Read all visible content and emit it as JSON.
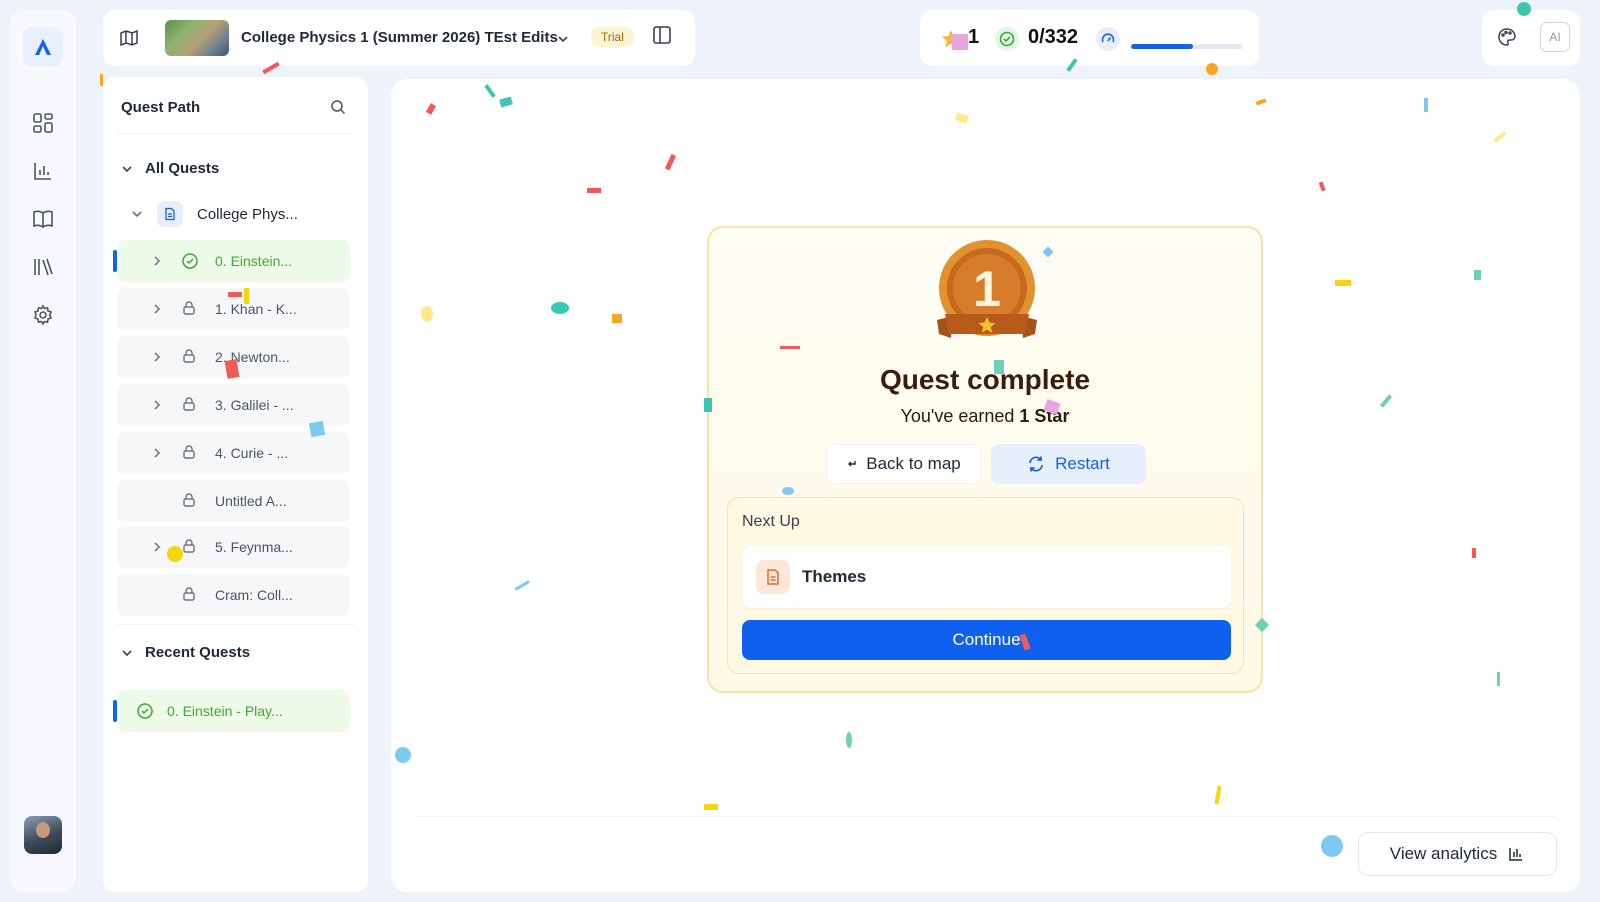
{
  "rail": {
    "nav_items": [
      "dashboard",
      "analytics",
      "book",
      "library",
      "settings"
    ]
  },
  "topbar": {
    "course_title": "College Physics 1 (Summer 2026) TEst Edits",
    "trial_badge": "Trial"
  },
  "stats": {
    "stars": "1",
    "progress": "0/332",
    "progress_fraction": 0.55
  },
  "top_right": {
    "ai_label": "AI"
  },
  "quest_panel": {
    "title": "Quest Path",
    "all_quests_label": "All Quests",
    "course_label": "College Phys...",
    "items": [
      {
        "label": "0. Einstein...",
        "state": "complete",
        "expandable": true
      },
      {
        "label": "1. Khan - K...",
        "state": "locked",
        "expandable": true
      },
      {
        "label": "2. Newton...",
        "state": "locked",
        "expandable": true
      },
      {
        "label": "3. Galilei - ...",
        "state": "locked",
        "expandable": true
      },
      {
        "label": "4. Curie - ...",
        "state": "locked",
        "expandable": true
      },
      {
        "label": "Untitled A...",
        "state": "locked",
        "expandable": false
      },
      {
        "label": "5. Feynma...",
        "state": "locked",
        "expandable": true
      },
      {
        "label": "Cram: Coll...",
        "state": "locked",
        "expandable": false
      }
    ],
    "recent_label": "Recent Quests",
    "recent_item": "0. Einstein - Play..."
  },
  "card": {
    "medal_number": "1",
    "title": "Quest complete",
    "subtitle_prefix": "You've earned ",
    "subtitle_bold": "1 Star",
    "back_label": "Back to map",
    "restart_label": "Restart",
    "next_up_label": "Next Up",
    "next_item": "Themes",
    "continue_label": "Continue"
  },
  "footer": {
    "analytics_label": "View analytics"
  },
  "colors": {
    "primary": "#1060f0",
    "success": "#3ea935",
    "medal": "#c8691f",
    "card_border": "#f5e3a8"
  }
}
